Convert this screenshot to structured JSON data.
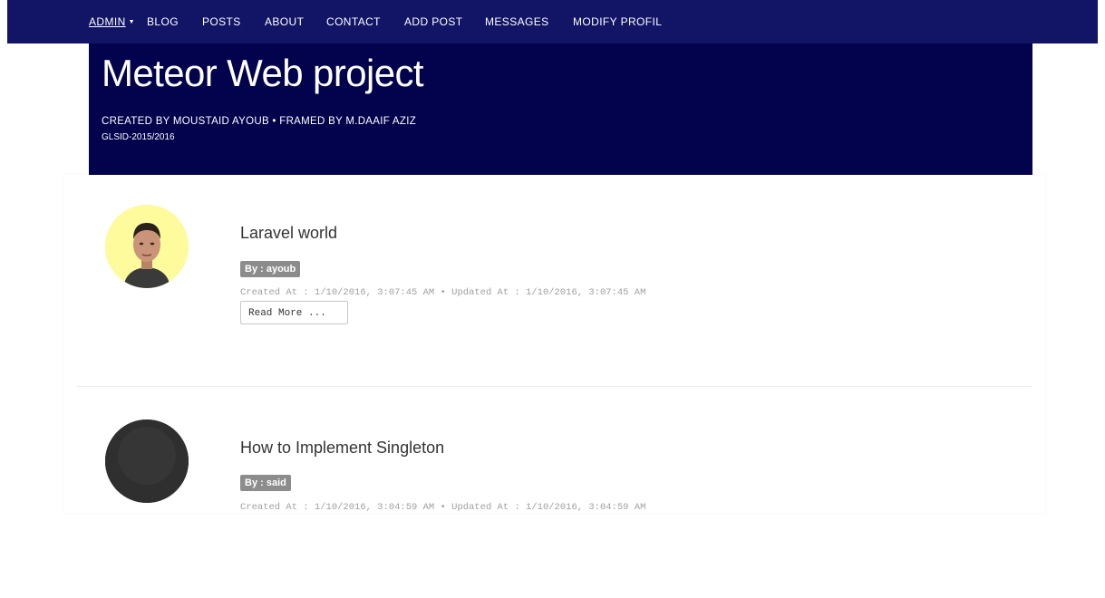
{
  "nav": {
    "items": [
      {
        "label": "ADMIN",
        "dropdown": true
      },
      {
        "label": "BLOG"
      },
      {
        "label": "POSTS"
      },
      {
        "label": "ABOUT"
      },
      {
        "label": "CONTACT"
      },
      {
        "label": "ADD POST"
      },
      {
        "label": "MESSAGES"
      },
      {
        "label": "MODIFY PROFIL"
      }
    ],
    "caret_glyph": "▼"
  },
  "header": {
    "title": "Meteor Web project",
    "credits": "CREATED BY MOUSTAID AYOUB • FRAMED BY M.DAAIF AZIZ",
    "year": "GLSID-2015/2016"
  },
  "posts": [
    {
      "title": "Laravel world",
      "author": "By : ayoub",
      "timestamps": "Created At : 1/10/2016, 3:07:45 AM • Updated At : 1/10/2016, 3:07:45 AM",
      "read_more": "Read More ...",
      "avatar_icon": "user-photo-icon"
    },
    {
      "title": "How to Implement Singleton",
      "author": "By : said",
      "timestamps": "Created At : 1/10/2016, 3:04:59 AM • Updated At : 1/10/2016, 3:04:59 AM",
      "avatar_icon": "user-photo-icon"
    }
  ],
  "colors": {
    "navbar": "#121466",
    "hero": "#02024d",
    "badge": "#8c8c8c",
    "avatar1_bg": "#fdfb9c",
    "avatar2_bg": "#333333"
  }
}
